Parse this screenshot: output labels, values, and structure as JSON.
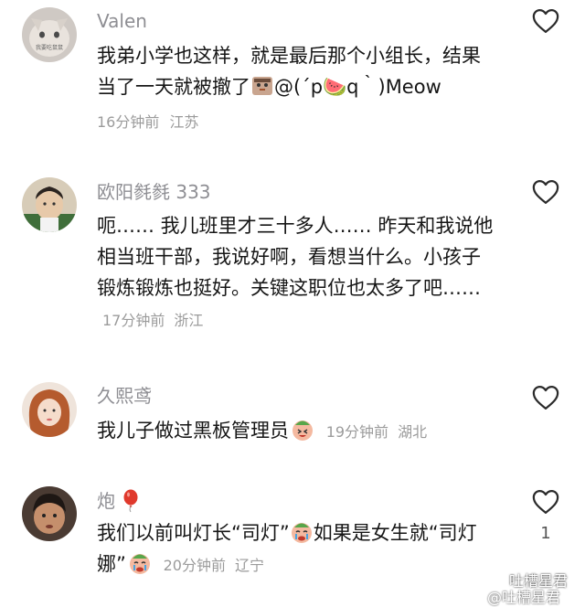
{
  "comments": [
    {
      "user": "Valen",
      "avatar_label": "我要吃鼠鼠",
      "text_before_emoji": "我弟小学也这样，就是最后那个小组长，结果当了一天就被撤了",
      "text_after_emoji": "@(´p🍉q｀)Meow",
      "time": "16分钟前",
      "location": "江苏",
      "icon": "heart-outline-icon"
    },
    {
      "user": "欧阳毵毵 333",
      "text": "呃…… 我儿班里才三十多人…… 昨天和我说他相当班干部，我说好啊，看想当什么。小孩子锻炼锻炼也挺好。关键这职位也太多了吧……",
      "time": "17分钟前",
      "location": "浙江",
      "icon": "heart-outline-icon"
    },
    {
      "user": "久熙鸢",
      "text": "我儿子做过黑板管理员",
      "time": "19分钟前",
      "location": "湖北",
      "icon": "heart-outline-icon"
    },
    {
      "user": "炮",
      "user_badge": "balloon-icon",
      "text_part1": "我们以前叫灯长“司灯”",
      "text_part2": "如果是女生就“司灯娜”",
      "time": "20分钟前",
      "location": "辽宁",
      "likes": "1",
      "icon": "heart-outline-icon"
    }
  ],
  "watermark": {
    "line1": "吐槽星君",
    "line2": "@吐槽星君"
  },
  "colors": {
    "username": "#8e8e93",
    "text": "#161616",
    "meta": "#9b9b9b",
    "heart": "#2b2b2b"
  }
}
